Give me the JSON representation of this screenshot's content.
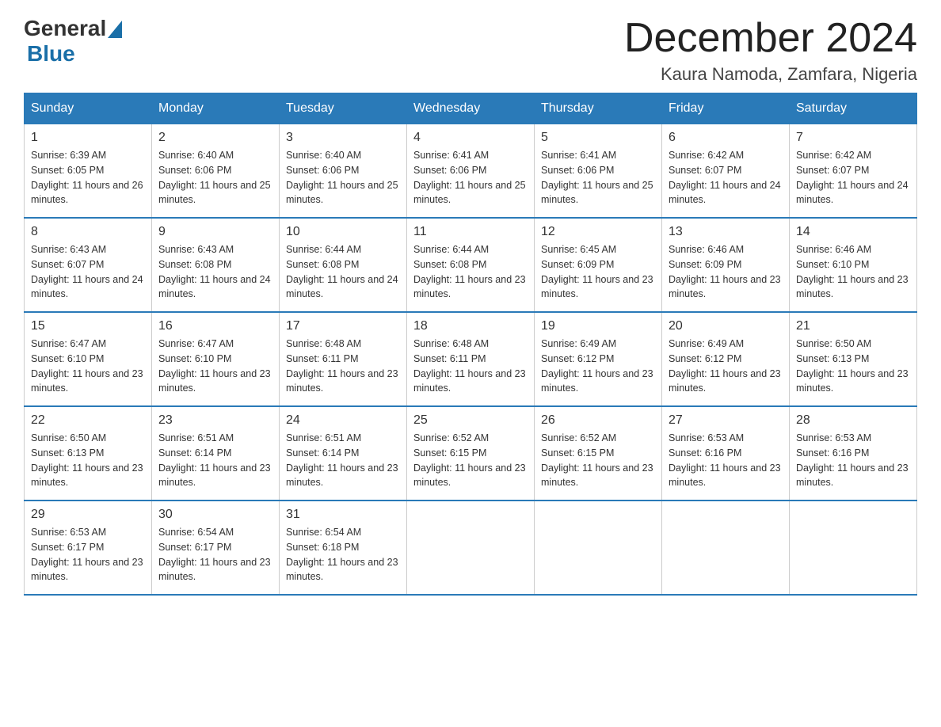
{
  "header": {
    "logo_general": "General",
    "logo_blue": "Blue",
    "month_title": "December 2024",
    "location": "Kaura Namoda, Zamfara, Nigeria"
  },
  "days_of_week": [
    "Sunday",
    "Monday",
    "Tuesday",
    "Wednesday",
    "Thursday",
    "Friday",
    "Saturday"
  ],
  "weeks": [
    [
      {
        "day": "1",
        "sunrise": "6:39 AM",
        "sunset": "6:05 PM",
        "daylight": "11 hours and 26 minutes."
      },
      {
        "day": "2",
        "sunrise": "6:40 AM",
        "sunset": "6:06 PM",
        "daylight": "11 hours and 25 minutes."
      },
      {
        "day": "3",
        "sunrise": "6:40 AM",
        "sunset": "6:06 PM",
        "daylight": "11 hours and 25 minutes."
      },
      {
        "day": "4",
        "sunrise": "6:41 AM",
        "sunset": "6:06 PM",
        "daylight": "11 hours and 25 minutes."
      },
      {
        "day": "5",
        "sunrise": "6:41 AM",
        "sunset": "6:06 PM",
        "daylight": "11 hours and 25 minutes."
      },
      {
        "day": "6",
        "sunrise": "6:42 AM",
        "sunset": "6:07 PM",
        "daylight": "11 hours and 24 minutes."
      },
      {
        "day": "7",
        "sunrise": "6:42 AM",
        "sunset": "6:07 PM",
        "daylight": "11 hours and 24 minutes."
      }
    ],
    [
      {
        "day": "8",
        "sunrise": "6:43 AM",
        "sunset": "6:07 PM",
        "daylight": "11 hours and 24 minutes."
      },
      {
        "day": "9",
        "sunrise": "6:43 AM",
        "sunset": "6:08 PM",
        "daylight": "11 hours and 24 minutes."
      },
      {
        "day": "10",
        "sunrise": "6:44 AM",
        "sunset": "6:08 PM",
        "daylight": "11 hours and 24 minutes."
      },
      {
        "day": "11",
        "sunrise": "6:44 AM",
        "sunset": "6:08 PM",
        "daylight": "11 hours and 23 minutes."
      },
      {
        "day": "12",
        "sunrise": "6:45 AM",
        "sunset": "6:09 PM",
        "daylight": "11 hours and 23 minutes."
      },
      {
        "day": "13",
        "sunrise": "6:46 AM",
        "sunset": "6:09 PM",
        "daylight": "11 hours and 23 minutes."
      },
      {
        "day": "14",
        "sunrise": "6:46 AM",
        "sunset": "6:10 PM",
        "daylight": "11 hours and 23 minutes."
      }
    ],
    [
      {
        "day": "15",
        "sunrise": "6:47 AM",
        "sunset": "6:10 PM",
        "daylight": "11 hours and 23 minutes."
      },
      {
        "day": "16",
        "sunrise": "6:47 AM",
        "sunset": "6:10 PM",
        "daylight": "11 hours and 23 minutes."
      },
      {
        "day": "17",
        "sunrise": "6:48 AM",
        "sunset": "6:11 PM",
        "daylight": "11 hours and 23 minutes."
      },
      {
        "day": "18",
        "sunrise": "6:48 AM",
        "sunset": "6:11 PM",
        "daylight": "11 hours and 23 minutes."
      },
      {
        "day": "19",
        "sunrise": "6:49 AM",
        "sunset": "6:12 PM",
        "daylight": "11 hours and 23 minutes."
      },
      {
        "day": "20",
        "sunrise": "6:49 AM",
        "sunset": "6:12 PM",
        "daylight": "11 hours and 23 minutes."
      },
      {
        "day": "21",
        "sunrise": "6:50 AM",
        "sunset": "6:13 PM",
        "daylight": "11 hours and 23 minutes."
      }
    ],
    [
      {
        "day": "22",
        "sunrise": "6:50 AM",
        "sunset": "6:13 PM",
        "daylight": "11 hours and 23 minutes."
      },
      {
        "day": "23",
        "sunrise": "6:51 AM",
        "sunset": "6:14 PM",
        "daylight": "11 hours and 23 minutes."
      },
      {
        "day": "24",
        "sunrise": "6:51 AM",
        "sunset": "6:14 PM",
        "daylight": "11 hours and 23 minutes."
      },
      {
        "day": "25",
        "sunrise": "6:52 AM",
        "sunset": "6:15 PM",
        "daylight": "11 hours and 23 minutes."
      },
      {
        "day": "26",
        "sunrise": "6:52 AM",
        "sunset": "6:15 PM",
        "daylight": "11 hours and 23 minutes."
      },
      {
        "day": "27",
        "sunrise": "6:53 AM",
        "sunset": "6:16 PM",
        "daylight": "11 hours and 23 minutes."
      },
      {
        "day": "28",
        "sunrise": "6:53 AM",
        "sunset": "6:16 PM",
        "daylight": "11 hours and 23 minutes."
      }
    ],
    [
      {
        "day": "29",
        "sunrise": "6:53 AM",
        "sunset": "6:17 PM",
        "daylight": "11 hours and 23 minutes."
      },
      {
        "day": "30",
        "sunrise": "6:54 AM",
        "sunset": "6:17 PM",
        "daylight": "11 hours and 23 minutes."
      },
      {
        "day": "31",
        "sunrise": "6:54 AM",
        "sunset": "6:18 PM",
        "daylight": "11 hours and 23 minutes."
      },
      null,
      null,
      null,
      null
    ]
  ],
  "labels": {
    "sunrise_prefix": "Sunrise: ",
    "sunset_prefix": "Sunset: ",
    "daylight_prefix": "Daylight: "
  }
}
